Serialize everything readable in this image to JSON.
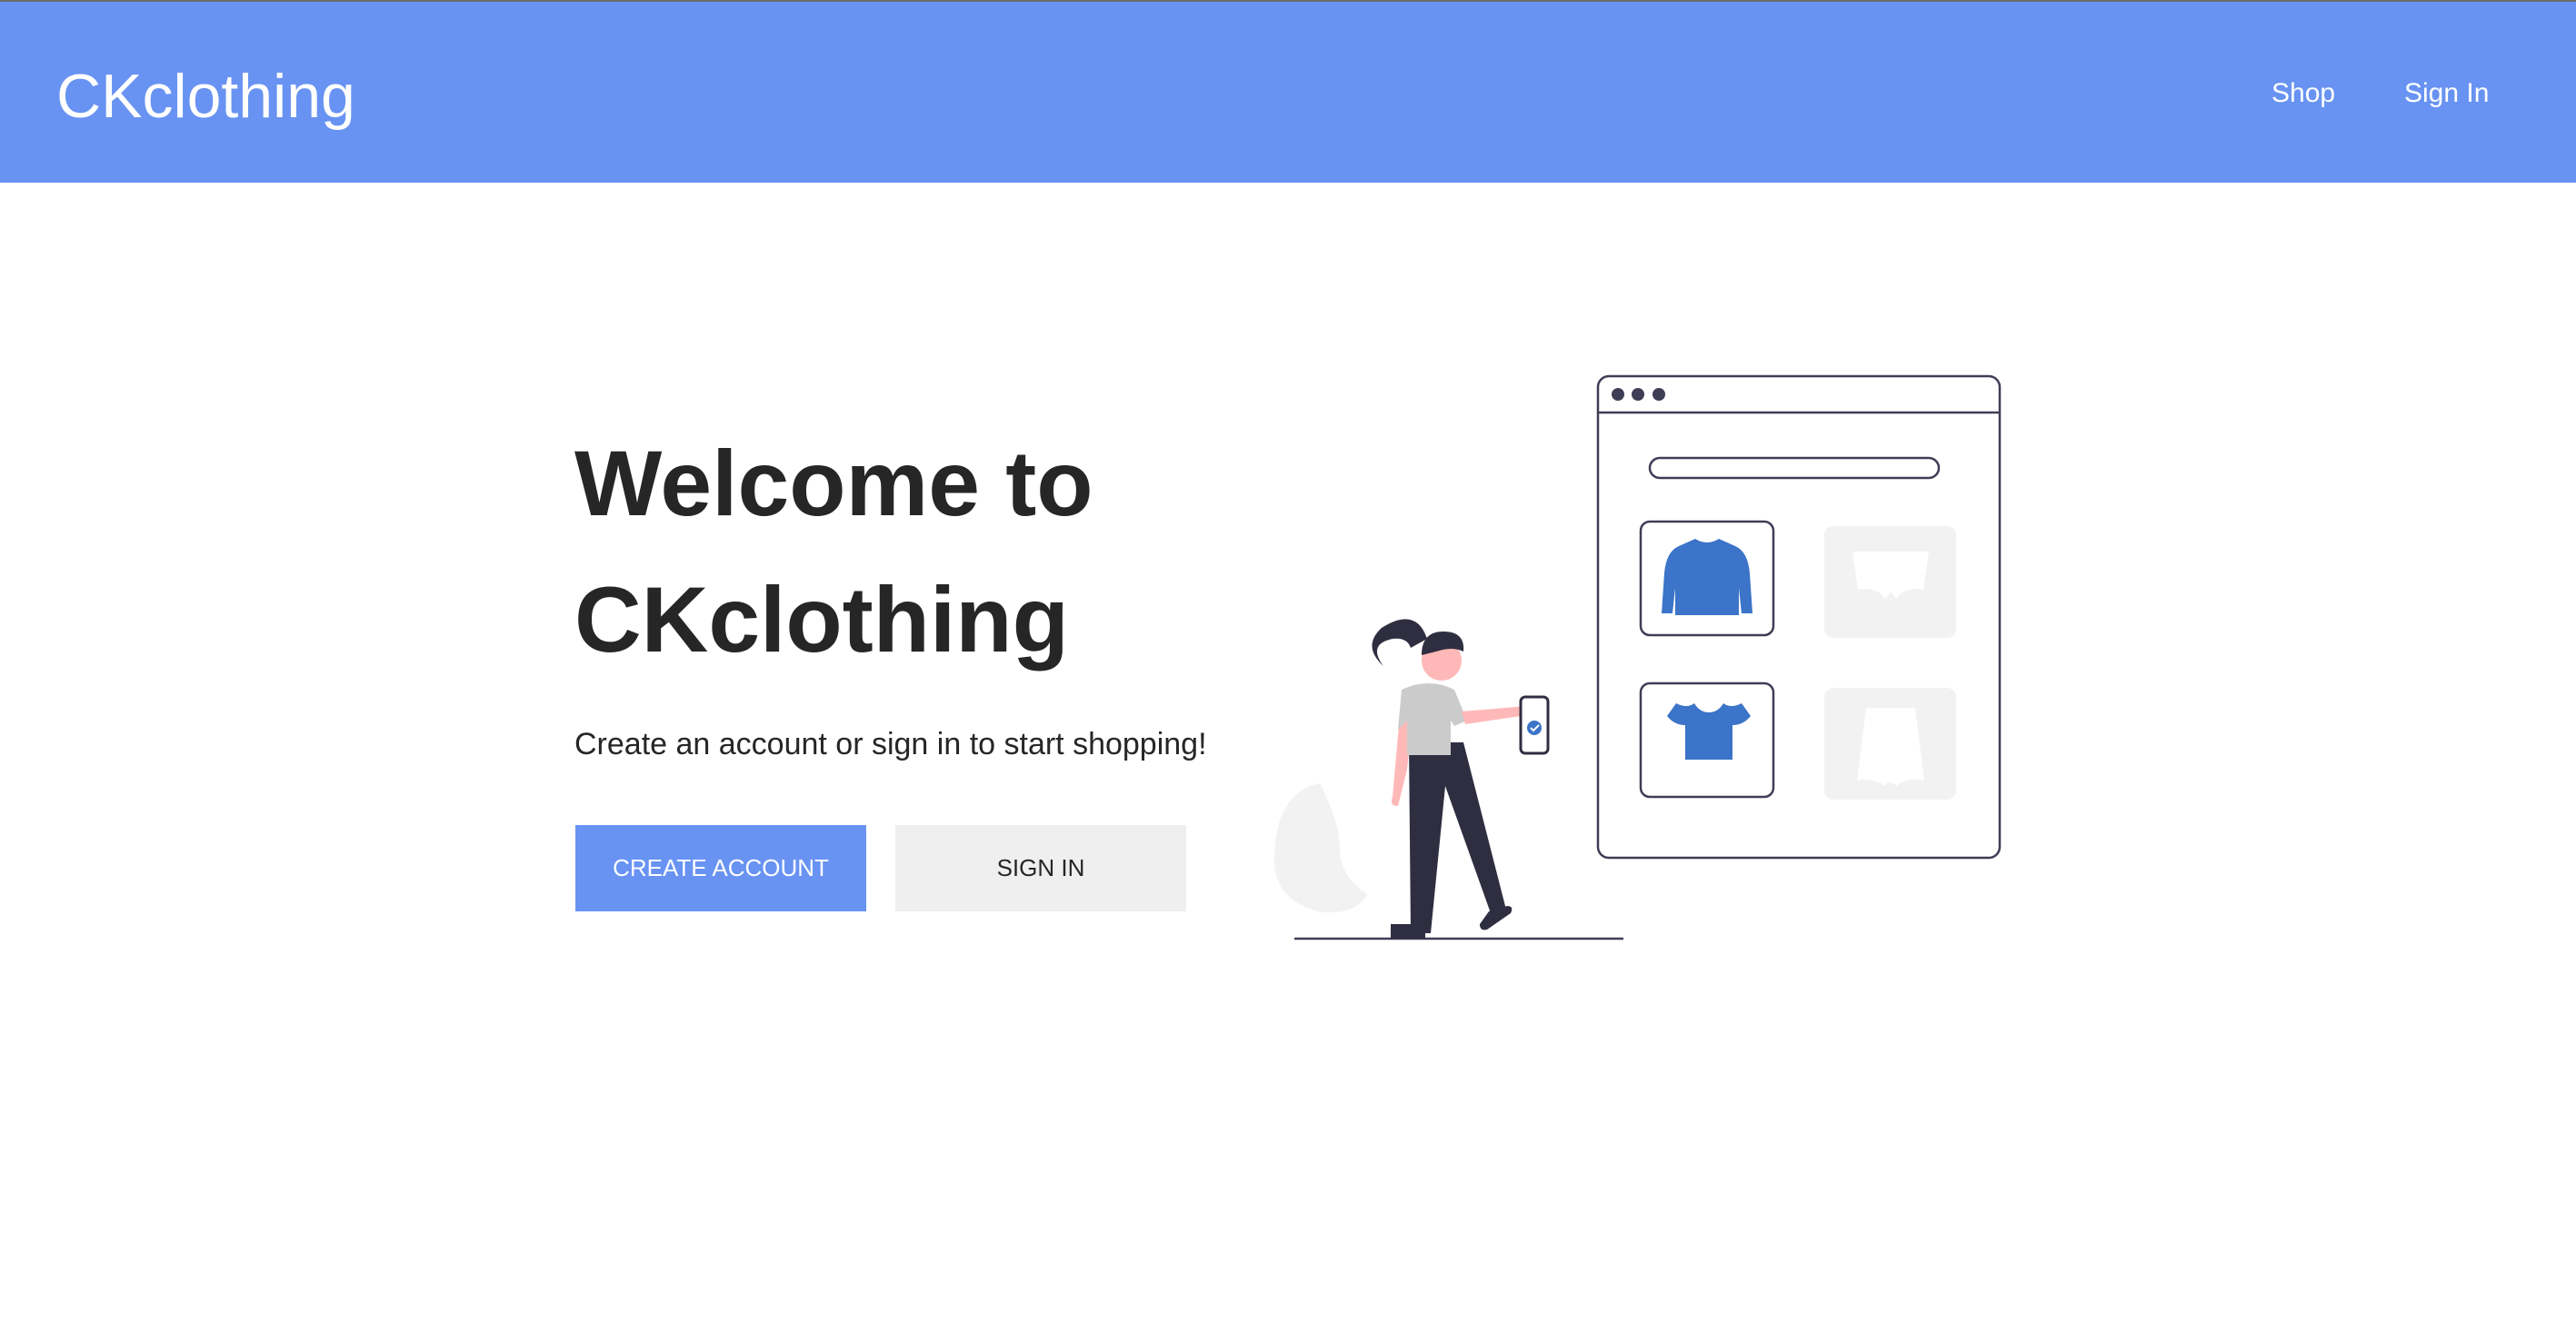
{
  "navbar": {
    "brand": "CKclothing",
    "links": [
      {
        "label": "Shop"
      },
      {
        "label": "Sign In"
      }
    ]
  },
  "hero": {
    "title_line1": "Welcome to",
    "title_line2": "CKclothing",
    "subtitle": "Create an account or sign in to start shopping!",
    "create_account_label": "CREATE ACCOUNT",
    "sign_in_label": "SIGN IN"
  },
  "colors": {
    "accent": "#6893f2",
    "text": "#262626",
    "secondary_button": "#efefef",
    "illustration_blue": "#3b74c8"
  }
}
